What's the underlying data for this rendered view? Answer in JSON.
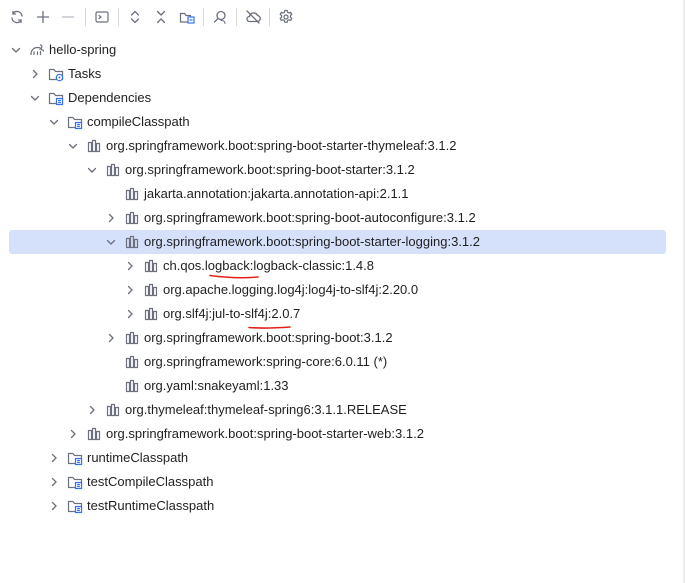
{
  "toolbar": {
    "buttons": [
      {
        "name": "reload-icon"
      },
      {
        "name": "expand-plus-icon"
      },
      {
        "name": "collapse-minus-icon"
      },
      {
        "name": "execute-task-icon"
      },
      {
        "name": "expand-all-icon"
      },
      {
        "name": "collapse-all-icon"
      },
      {
        "name": "dependencies-analyzer-icon"
      },
      {
        "name": "analyze-dependencies-icon"
      },
      {
        "name": "offline-mode-icon"
      },
      {
        "name": "settings-gear-icon"
      }
    ]
  },
  "tree": {
    "rows": [
      {
        "label": "hello-spring",
        "icon": "gradle-elephant-icon",
        "expanded": true,
        "depth": 0
      },
      {
        "label": "Tasks",
        "icon": "tasks-folder-icon",
        "expanded": false,
        "depth": 1
      },
      {
        "label": "Dependencies",
        "icon": "dependencies-folder-icon",
        "expanded": true,
        "depth": 1
      },
      {
        "label": "compileClasspath",
        "icon": "configuration-folder-icon",
        "expanded": true,
        "depth": 2
      },
      {
        "label": "org.springframework.boot:spring-boot-starter-thymeleaf:3.1.2",
        "icon": "library-icon",
        "expanded": true,
        "depth": 3
      },
      {
        "label": "org.springframework.boot:spring-boot-starter:3.1.2",
        "icon": "library-icon",
        "expanded": true,
        "depth": 4
      },
      {
        "label": "jakarta.annotation:jakarta.annotation-api:2.1.1",
        "icon": "library-icon",
        "expanded": null,
        "depth": 5
      },
      {
        "label": "org.springframework.boot:spring-boot-autoconfigure:3.1.2",
        "icon": "library-icon",
        "expanded": false,
        "depth": 5
      },
      {
        "label": "org.springframework.boot:spring-boot-starter-logging:3.1.2",
        "icon": "library-icon",
        "expanded": true,
        "depth": 5,
        "selected": true
      },
      {
        "label": "ch.qos.logback:logback-classic:1.4.8",
        "icon": "library-icon",
        "expanded": false,
        "depth": 6
      },
      {
        "label": "org.apache.logging.log4j:log4j-to-slf4j:2.20.0",
        "icon": "library-icon",
        "expanded": false,
        "depth": 6
      },
      {
        "label": "org.slf4j:jul-to-slf4j:2.0.7",
        "icon": "library-icon",
        "expanded": false,
        "depth": 6
      },
      {
        "label": "org.springframework.boot:spring-boot:3.1.2",
        "icon": "library-icon",
        "expanded": false,
        "depth": 5
      },
      {
        "label": "org.springframework:spring-core:6.0.11 (*)",
        "icon": "library-icon",
        "expanded": null,
        "depth": 5
      },
      {
        "label": "org.yaml:snakeyaml:1.33",
        "icon": "library-icon",
        "expanded": null,
        "depth": 5
      },
      {
        "label": "org.thymeleaf:thymeleaf-spring6:3.1.1.RELEASE",
        "icon": "library-icon",
        "expanded": false,
        "depth": 4
      },
      {
        "label": "org.springframework.boot:spring-boot-starter-web:3.1.2",
        "icon": "library-icon",
        "expanded": false,
        "depth": 3
      },
      {
        "label": "runtimeClasspath",
        "icon": "configuration-folder-icon",
        "expanded": false,
        "depth": 2
      },
      {
        "label": "testCompileClasspath",
        "icon": "configuration-folder-icon",
        "expanded": false,
        "depth": 2
      },
      {
        "label": "testRuntimeClasspath",
        "icon": "configuration-folder-icon",
        "expanded": false,
        "depth": 2
      }
    ]
  },
  "colors": {
    "selection": "#d5e1fb",
    "icon_gray": "#6c707e",
    "icon_blue": "#3574f0",
    "annotation_red": "#e0201b"
  }
}
